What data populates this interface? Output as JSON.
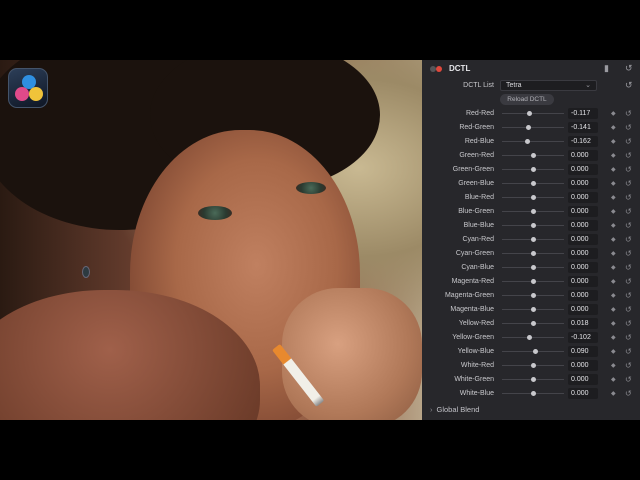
{
  "panel": {
    "title": "DCTL",
    "list_label": "DCTL List",
    "list_value": "Tetra",
    "reload_label": "Reload DCTL",
    "footer_label": "Global Blend",
    "dot_colors": [
      "#555558",
      "#e0483c"
    ]
  },
  "params": [
    {
      "label": "Red-Red",
      "value": "-0.117"
    },
    {
      "label": "Red-Green",
      "value": "-0.141"
    },
    {
      "label": "Red-Blue",
      "value": "-0.162"
    },
    {
      "label": "Green-Red",
      "value": "0.000"
    },
    {
      "label": "Green-Green",
      "value": "0.000"
    },
    {
      "label": "Green-Blue",
      "value": "0.000"
    },
    {
      "label": "Blue-Red",
      "value": "0.000"
    },
    {
      "label": "Blue-Green",
      "value": "0.000"
    },
    {
      "label": "Blue-Blue",
      "value": "0.000"
    },
    {
      "label": "Cyan-Red",
      "value": "0.000"
    },
    {
      "label": "Cyan-Green",
      "value": "0.000"
    },
    {
      "label": "Cyan-Blue",
      "value": "0.000"
    },
    {
      "label": "Magenta-Red",
      "value": "0.000"
    },
    {
      "label": "Magenta-Green",
      "value": "0.000"
    },
    {
      "label": "Magenta-Blue",
      "value": "0.000"
    },
    {
      "label": "Yellow-Red",
      "value": "0.018"
    },
    {
      "label": "Yellow-Green",
      "value": "-0.102"
    },
    {
      "label": "Yellow-Blue",
      "value": "0.090"
    },
    {
      "label": "White-Red",
      "value": "0.000"
    },
    {
      "label": "White-Green",
      "value": "0.000"
    },
    {
      "label": "White-Blue",
      "value": "0.000"
    }
  ]
}
